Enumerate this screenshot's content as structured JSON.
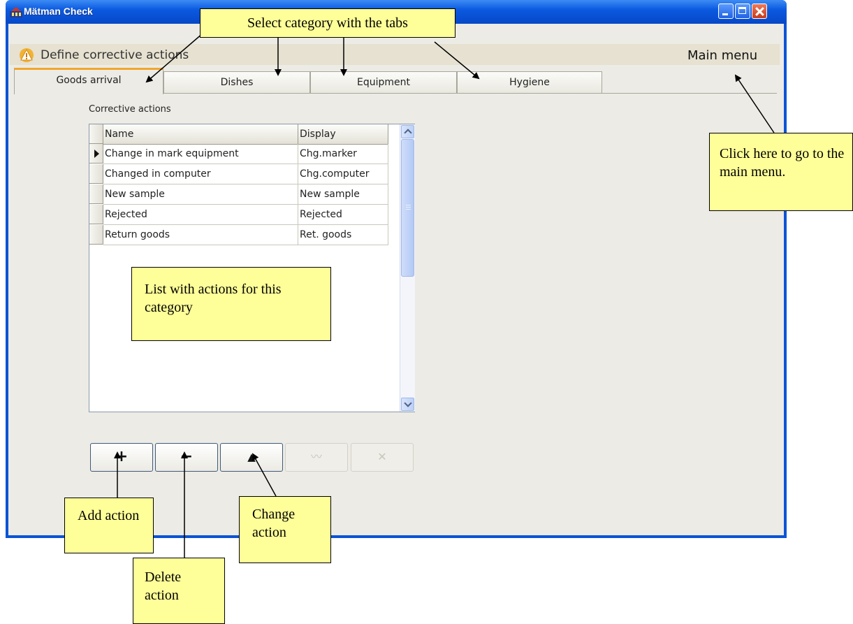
{
  "window": {
    "title": "Mätman Check"
  },
  "header": {
    "title": "Define corrective actions",
    "main_menu_label": "Main menu"
  },
  "tabs": [
    {
      "label": "Goods arrival",
      "active": true
    },
    {
      "label": "Dishes",
      "active": false
    },
    {
      "label": "Equipment",
      "active": false
    },
    {
      "label": "Hygiene",
      "active": false
    }
  ],
  "section": {
    "label": "Corrective actions"
  },
  "grid": {
    "columns": [
      "Name",
      "Display"
    ],
    "rows": [
      {
        "name": "Change in mark equipment",
        "display": "Chg.marker",
        "current": true
      },
      {
        "name": "Changed in computer",
        "display": "Chg.computer",
        "current": false
      },
      {
        "name": "New sample",
        "display": "New sample",
        "current": false
      },
      {
        "name": "Rejected",
        "display": "Rejected",
        "current": false
      },
      {
        "name": "Return goods",
        "display": "Ret. goods",
        "current": false
      }
    ]
  },
  "toolbar": {
    "add_label": "+",
    "delete_label": "−",
    "change_label": "▲",
    "disabled_1_label": "〰",
    "disabled_2_label": "✕"
  },
  "annotations": {
    "tabs_note": "Select category with the tabs",
    "main_menu_note": "Click here to go to the main menu.",
    "list_note": "List with actions for this category",
    "add_note": "Add action",
    "delete_note": "Delete action",
    "change_note": "Change action"
  },
  "colors": {
    "titlebar": "#0b5ae0",
    "callout_fill": "#ffff99",
    "active_tab_accent": "#f2a62c",
    "client_bg": "#ecebe5"
  }
}
